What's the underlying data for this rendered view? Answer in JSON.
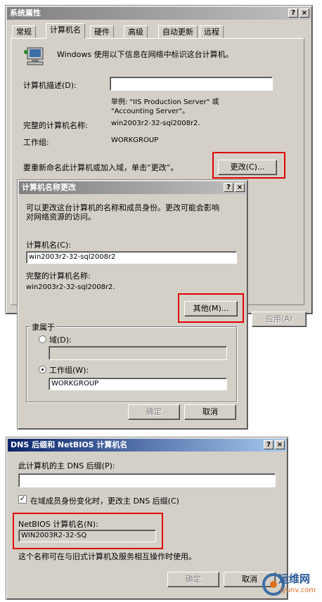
{
  "sysprops": {
    "title": "系统属性",
    "tabs": [
      "常规",
      "计算机名",
      "硬件",
      "高级",
      "自动更新",
      "远程"
    ],
    "info": "Windows 使用以下信息在网络中标识这台计算机。",
    "desc_label": "计算机描述(D):",
    "desc_value": "",
    "example": "举例: \"IIS Production Server\" 或",
    "example2": "\"Accounting Server\"。",
    "fullname_label": "完整的计算机名称:",
    "fullname_value": "win2003r2-32-sql2008r2.",
    "workgroup_label": "工作组:",
    "workgroup_value": "WORKGROUP",
    "rename_text": "要重新命名此计算机或加入域，单击“更改”。",
    "change_button": "更改(C)...",
    "apply_button": "应用(A)",
    "help_btn": "?",
    "close_btn": "×"
  },
  "rename": {
    "title": "计算机名称更改",
    "info1": "可以更改这台计算机的名称和成员身份。更改可能会影响",
    "info2": "对网络资源的访问。",
    "name_label": "计算机名(C):",
    "name_value": "win2003r2-32-sql2008r2",
    "full_label": "完整的计算机名称:",
    "full_value": "win2003r2-32-sql2008r2.",
    "more_button": "其他(M)...",
    "member_group": "隶属于",
    "domain_label": "域(D):",
    "domain_value": "",
    "workgroup_label": "工作组(W):",
    "workgroup_value": "WORKGROUP",
    "ok_button": "确定",
    "cancel_button": "取消",
    "help_btn": "?",
    "close_btn": "×"
  },
  "dns": {
    "title": "DNS 后缀和 NetBIOS 计算机名",
    "primary_label": "此计算机的主 DNS 后缀(P):",
    "primary_value": "",
    "change_check_label": "在域成员身份变化时，更改主 DNS 后缀(C)",
    "netbios_label": "NetBIOS 计算机名(N):",
    "netbios_value": "WIN2003R2-32-SQ",
    "note": "这个名称可在与旧式计算机及服务相互操作时使用。",
    "ok_button": "确定",
    "cancel_button": "取消",
    "help_btn": "?",
    "close_btn": "×"
  },
  "watermark": {
    "cn": "运维网",
    "en": "iyunv.com"
  }
}
